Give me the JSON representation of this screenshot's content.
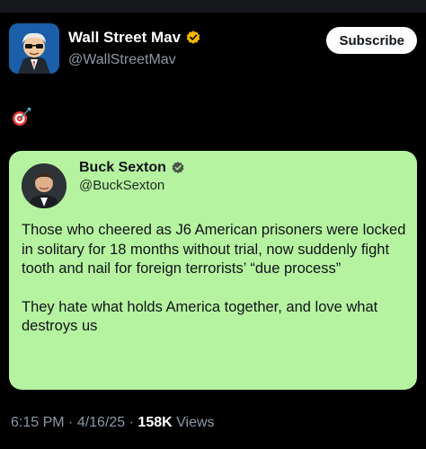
{
  "post": {
    "author_name": "Wall Street Mav",
    "author_handle": "@WallStreetMav",
    "subscribe_label": "Subscribe",
    "body_emoji": "target-emoji"
  },
  "quote": {
    "author_name": "Buck Sexton",
    "author_handle": "@BuckSexton",
    "paragraphs": [
      "Those who cheered as J6 American prisoners were locked in solitary for 18 months without trial, now suddenly fight tooth and nail for foreign terrorists’ “due process”",
      "They hate what holds America together, and love what destroys us"
    ],
    "background_color": "#b6f3a0"
  },
  "meta": {
    "time": "6:15 PM",
    "sep": " · ",
    "date": "4/16/25",
    "views_count": "158K",
    "views_label": "Views"
  },
  "colors": {
    "background": "#000000",
    "verified_badge": "#f4b400",
    "muted_text": "#8b98a5"
  }
}
